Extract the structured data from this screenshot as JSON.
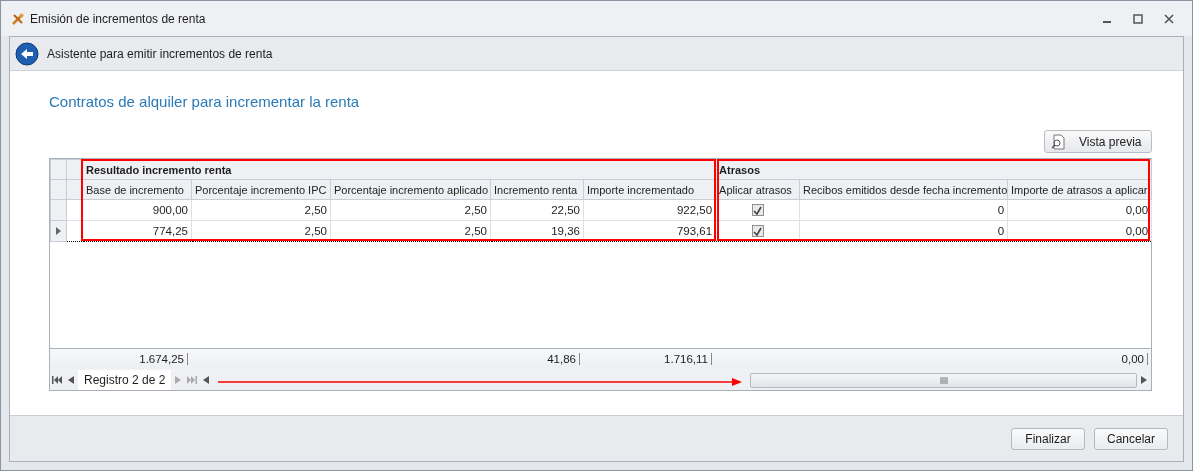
{
  "window": {
    "title": "Emisión de incrementos de renta"
  },
  "wizard": {
    "title": "Asistente para emitir incrementos de renta"
  },
  "page_title": "Contratos de alquiler para incrementar la renta",
  "preview_button": "Vista previa",
  "table": {
    "bands": [
      {
        "label": "Resultado incremento renta",
        "columns": [
          {
            "label": "Base de incremento",
            "kind": "number",
            "total": "1.674,25"
          },
          {
            "label": "Porcentaje incremento IPC",
            "kind": "number"
          },
          {
            "label": "Porcentaje incremento aplicado",
            "kind": "number"
          },
          {
            "label": "Incremento renta",
            "kind": "number",
            "total": "41,86"
          },
          {
            "label": "Importe incrementado",
            "kind": "number",
            "total": "1.716,11"
          }
        ]
      },
      {
        "label": "Atrasos",
        "columns": [
          {
            "label": "Aplicar atrasos",
            "kind": "check"
          },
          {
            "label": "Recibos emitidos desde fecha incremento",
            "kind": "number"
          },
          {
            "label": "Importe de atrasos a aplicar",
            "kind": "number",
            "total": "0,00"
          }
        ]
      }
    ],
    "rows": [
      {
        "selected": false,
        "cells": [
          "900,00",
          "2,50",
          "2,50",
          "22,50",
          "922,50",
          true,
          "0",
          "0,00"
        ]
      },
      {
        "selected": true,
        "cells": [
          "774,25",
          "2,50",
          "2,50",
          "19,36",
          "793,61",
          true,
          "0",
          "0,00"
        ]
      }
    ]
  },
  "navigator": {
    "record": "Registro 2 de 2"
  },
  "buttons": [
    "Finalizar",
    "Cancelar"
  ]
}
